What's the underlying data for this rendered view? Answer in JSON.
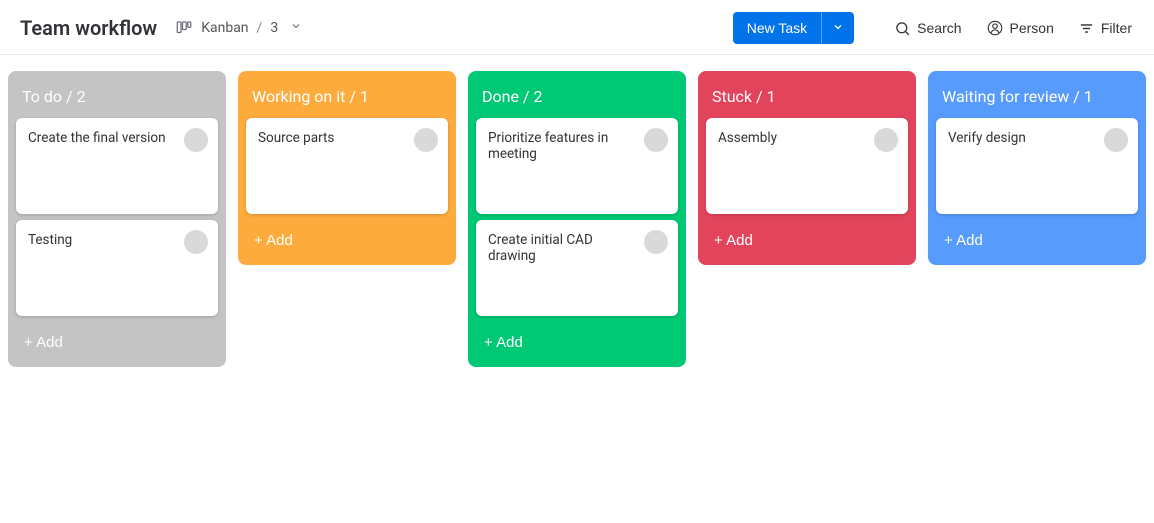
{
  "header": {
    "title": "Team workflow",
    "view_label": "Kanban",
    "view_count": "3",
    "new_task_label": "New Task",
    "search_label": "Search",
    "person_label": "Person",
    "filter_label": "Filter"
  },
  "add_label": "+ Add",
  "columns": [
    {
      "id": "todo",
      "title": "To do",
      "count": 2,
      "color": "#c4c4c4",
      "cards": [
        {
          "title": "Create the final version"
        },
        {
          "title": "Testing"
        }
      ]
    },
    {
      "id": "work",
      "title": "Working on it",
      "count": 1,
      "color": "#fdab3d",
      "cards": [
        {
          "title": "Source parts"
        }
      ]
    },
    {
      "id": "done",
      "title": "Done",
      "count": 2,
      "color": "#00c875",
      "cards": [
        {
          "title": "Prioritize features in meeting"
        },
        {
          "title": "Create initial CAD drawing"
        }
      ]
    },
    {
      "id": "stuck",
      "title": "Stuck",
      "count": 1,
      "color": "#e2445c",
      "cards": [
        {
          "title": "Assembly"
        }
      ]
    },
    {
      "id": "wait",
      "title": "Waiting for review",
      "count": 1,
      "color": "#579bfc",
      "cards": [
        {
          "title": "Verify design"
        }
      ]
    }
  ]
}
